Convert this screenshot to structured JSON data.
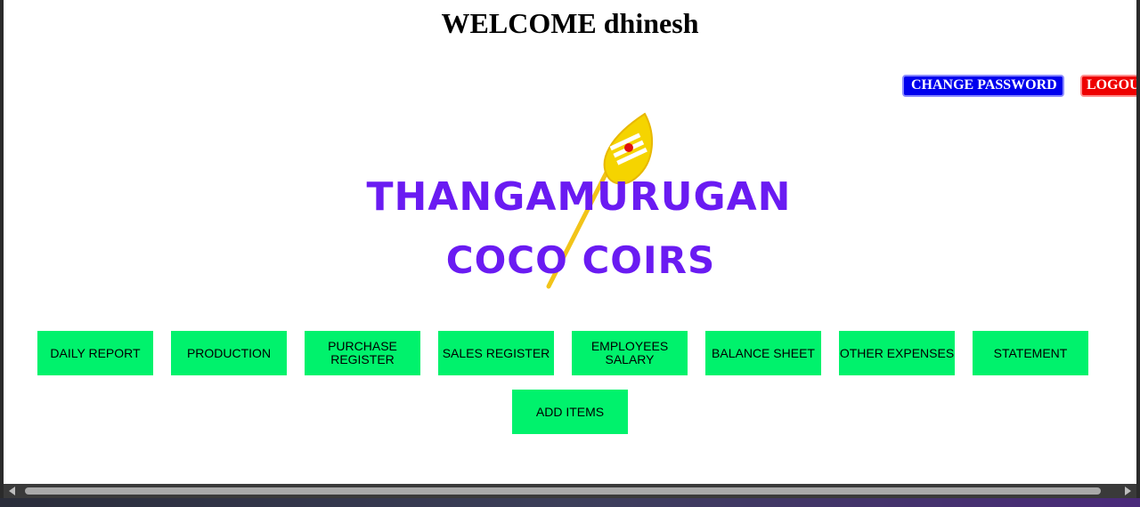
{
  "header": {
    "welcome": "WELCOME dhinesh",
    "change_password": "CHANGE PASSWORD",
    "logout": "LOGOU"
  },
  "logo": {
    "line1": "THANGAMURUGAN",
    "line2": "COCO COIRS",
    "text_color": "#6a1bf2"
  },
  "menu": {
    "daily_report": "DAILY REPORT",
    "production": "PRODUCTION",
    "purchase_register": "PURCHASE REGISTER",
    "sales_register": "SALES REGISTER",
    "employees_salary": "EMPLOYEES SALARY",
    "balance_sheet": "BALANCE SHEET",
    "other_expenses": "OTHER EXPENSES",
    "statement": "STATEMENT",
    "add_items": "ADD ITEMS"
  },
  "colors": {
    "menu_button": "#00f26c",
    "change_password_button": "#0000ee",
    "logout_button": "#ee0000"
  }
}
